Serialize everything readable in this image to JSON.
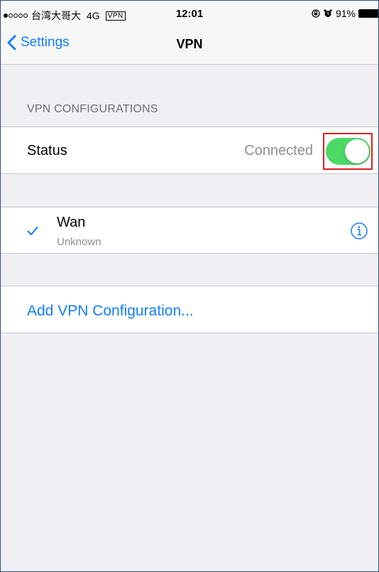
{
  "status_bar": {
    "carrier": "台湾大哥大",
    "network": "4G",
    "vpn_badge": "VPN",
    "time": "12:01",
    "battery": "91%"
  },
  "navbar": {
    "back_label": "Settings",
    "title": "VPN"
  },
  "vpn_section": {
    "header": "VPN CONFIGURATIONS",
    "status_label": "Status",
    "status_value": "Connected",
    "toggle_on": true
  },
  "configurations": [
    {
      "name": "Wan",
      "status": "Unknown",
      "selected": true
    }
  ],
  "add_configuration_label": "Add VPN Configuration...",
  "colors": {
    "accent": "#147efb",
    "toggle_on": "#4cd964",
    "highlight": "#e02020",
    "background": "#efeff4"
  }
}
